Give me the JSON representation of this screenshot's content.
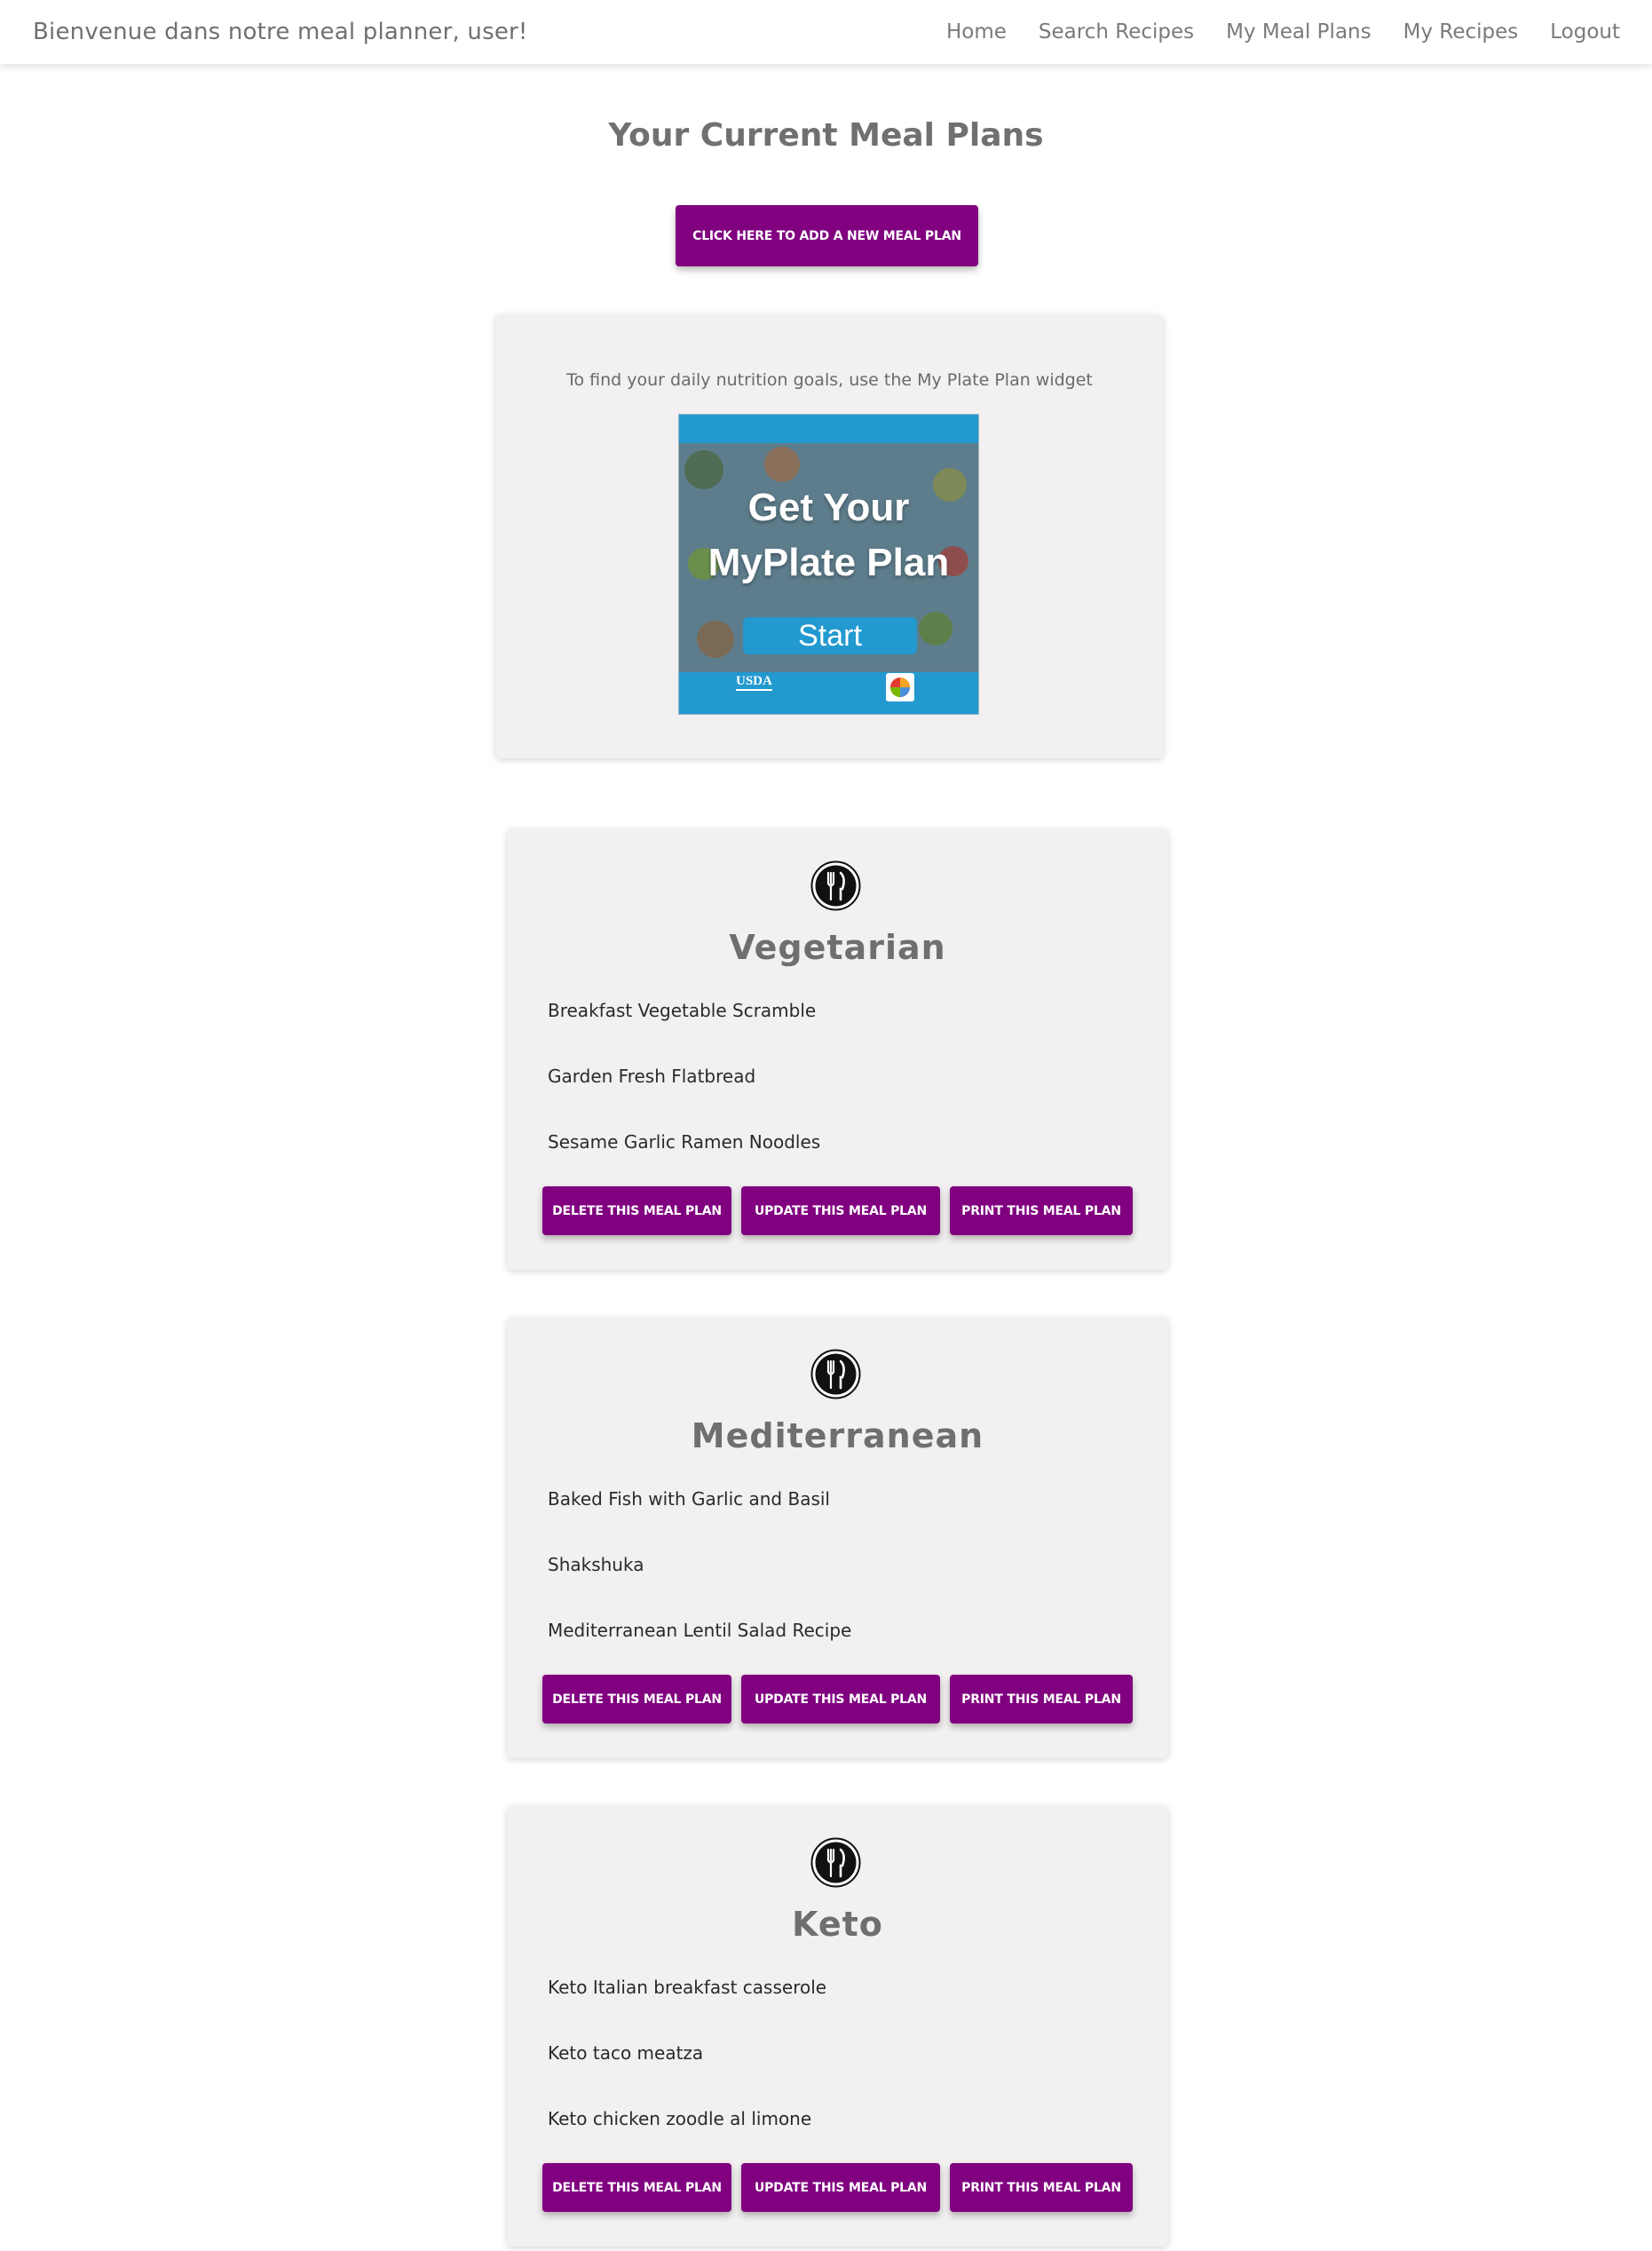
{
  "navbar": {
    "brand": "Bienvenue dans notre meal planner, user!",
    "links": [
      "Home",
      "Search Recipes",
      "My Meal Plans",
      "My Recipes",
      "Logout"
    ]
  },
  "page": {
    "title": "Your Current Meal Plans",
    "add_button": "Click here to add a new meal plan"
  },
  "widget": {
    "text": "To find your daily nutrition goals, use the My Plate Plan widget",
    "banner_title_line1": "Get Your",
    "banner_title_line2": "MyPlate Plan",
    "banner_start": "Start",
    "banner_logo": "USDA"
  },
  "plans": [
    {
      "name": "Vegetarian",
      "recipes": [
        "Breakfast Vegetable Scramble",
        "Garden Fresh Flatbread",
        "Sesame Garlic Ramen Noodles"
      ]
    },
    {
      "name": "Mediterranean",
      "recipes": [
        "Baked Fish with Garlic and Basil",
        "Shakshuka",
        "Mediterranean Lentil Salad Recipe"
      ]
    },
    {
      "name": "Keto",
      "recipes": [
        "Keto Italian breakfast casserole",
        "Keto taco meatza",
        "Keto chicken zoodle al limone"
      ]
    }
  ],
  "plan_buttons": {
    "delete": "Delete this meal plan",
    "update": "Update this meal plan",
    "print": "Print this meal plan"
  },
  "colors": {
    "accent": "#800080",
    "card_bg": "#f2f0f0",
    "banner_blue": "#2299cf"
  }
}
